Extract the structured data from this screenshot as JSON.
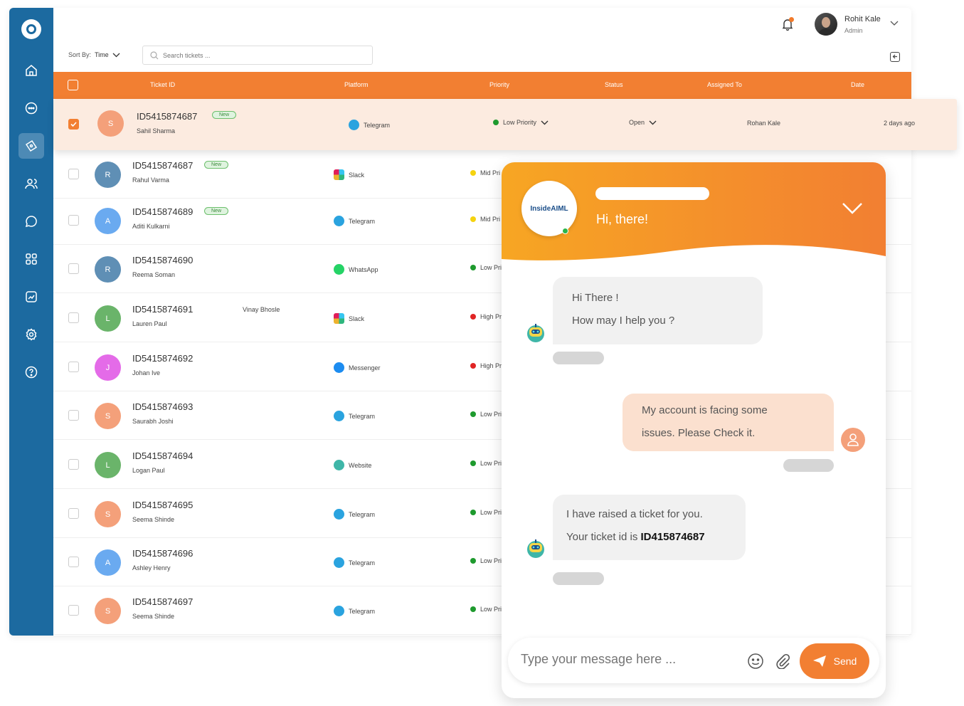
{
  "user": {
    "name": "Rohit Kale",
    "role": "Admin"
  },
  "toolbar": {
    "sort_label": "Sort By:",
    "sort_value": "Time",
    "search_placeholder": "Search tickets ..."
  },
  "table": {
    "columns": [
      "Ticket ID",
      "Platform",
      "Priority",
      "Status",
      "Assigned To",
      "Date"
    ],
    "selected": {
      "ticket_id": "ID5415874687",
      "badge": "New",
      "name": "Sahil Sharma",
      "initial": "S",
      "platform": "Telegram",
      "priority": "Low Priority",
      "status": "Open",
      "assigned_to": "Rohan Kale",
      "date": "2 days ago"
    },
    "rows": [
      {
        "ticket_id": "ID5415874687",
        "badge": "New",
        "name": "Rahul Varma",
        "initial": "R",
        "platform": "Slack",
        "priority": "Mid Pri"
      },
      {
        "ticket_id": "ID5415874689",
        "badge": "New",
        "name": "Aditi Kulkarni",
        "initial": "A",
        "platform": "Telegram",
        "priority": "Mid Pri"
      },
      {
        "ticket_id": "ID5415874690",
        "name": "Reema Soman",
        "initial": "R",
        "platform": "WhatsApp",
        "priority": "Low Pri"
      },
      {
        "ticket_id": "ID5415874691",
        "name": "Lauren Paul",
        "initial": "L",
        "platform": "Slack",
        "priority": "High Pr",
        "extra": "Vinay Bhosle"
      },
      {
        "ticket_id": "ID5415874692",
        "name": "Johan Ive",
        "initial": "J",
        "platform": "Messenger",
        "priority": "High Pr"
      },
      {
        "ticket_id": "ID5415874693",
        "name": "Saurabh Joshi",
        "initial": "S",
        "platform": "Telegram",
        "priority": "Low Pri"
      },
      {
        "ticket_id": "ID5415874694",
        "name": "Logan Paul",
        "initial": "L",
        "platform": "Website",
        "priority": "Low Pri"
      },
      {
        "ticket_id": "ID5415874695",
        "name": "Seema Shinde",
        "initial": "S",
        "platform": "Telegram",
        "priority": "Low Pri"
      },
      {
        "ticket_id": "ID5415874696",
        "name": "Ashley Henry",
        "initial": "A",
        "platform": "Telegram",
        "priority": "Low Pri"
      },
      {
        "ticket_id": "ID5415874697",
        "name": "Seema Shinde",
        "initial": "S",
        "platform": "Telegram",
        "priority": "Low Pri"
      }
    ]
  },
  "chat": {
    "brand": "InsideAIML",
    "greeting": "Hi, there!",
    "bot_msg1_line1": "Hi There !",
    "bot_msg1_line2": "How may I help you ?",
    "user_msg_line1": "My account is facing some",
    "user_msg_line2": "issues. Please Check it.",
    "bot_msg2_line1": "I have raised a ticket for you.",
    "bot_msg2_line2_prefix": "Your ticket id is ",
    "bot_msg2_ticket": "ID415874687",
    "input_placeholder": "Type your message here ...",
    "send_label": "Send"
  },
  "colors": {
    "sidebar": "#1c6aa0",
    "accent": "#f27f32",
    "low": "#1e9a2e",
    "mid": "#f5d30f",
    "high": "#e02424"
  }
}
